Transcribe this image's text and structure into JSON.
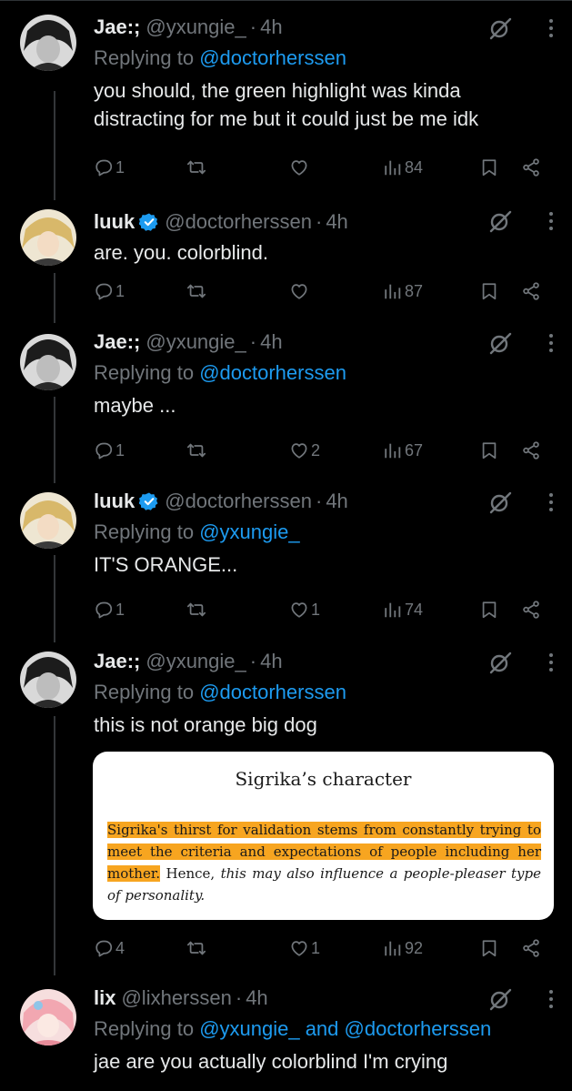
{
  "colors": {
    "background": "#000000",
    "text_primary": "#e7e9ea",
    "text_secondary": "#71767b",
    "mention_blue": "#1d9bf0",
    "verified_blue": "#1d9bf0",
    "highlight_orange": "#f7a520",
    "thread_line": "#333639"
  },
  "icons": {
    "reply": "speech-bubble-icon",
    "retweet": "retweet-arrows-icon",
    "like": "heart-icon",
    "views": "bar-chart-icon",
    "bookmark": "bookmark-icon",
    "share": "share-nodes-icon",
    "grok": "grok-slash-circle-icon",
    "more": "vertical-ellipsis-icon",
    "verified": "verified-badge-icon"
  },
  "tweets": [
    {
      "name": "Jae:;",
      "handle": "@yxungie_",
      "dot": "·",
      "time": "4h",
      "replying_prefix": "Replying to ",
      "replying_to": "@doctorherssen",
      "text": "you should, the green highlight was kinda distracting for me but it could just be me idk",
      "reply_count": "1",
      "like_count": "",
      "views": "84"
    },
    {
      "name": "luuk",
      "verified": true,
      "handle": "@doctorherssen",
      "dot": "·",
      "time": "4h",
      "text": "are. you. colorblind.",
      "reply_count": "1",
      "like_count": "",
      "views": "87"
    },
    {
      "name": "Jae:;",
      "handle": "@yxungie_",
      "dot": "·",
      "time": "4h",
      "replying_prefix": "Replying to ",
      "replying_to": "@doctorherssen",
      "text": "maybe ...",
      "reply_count": "1",
      "like_count": "2",
      "views": "67"
    },
    {
      "name": "luuk",
      "verified": true,
      "handle": "@doctorherssen",
      "dot": "·",
      "time": "4h",
      "replying_prefix": "Replying to ",
      "replying_to": "@yxungie_",
      "text": "IT'S ORANGE...",
      "reply_count": "1",
      "like_count": "1",
      "views": "74"
    },
    {
      "name": "Jae:;",
      "handle": "@yxungie_",
      "dot": "·",
      "time": "4h",
      "replying_prefix": "Replying to ",
      "replying_to": "@doctorherssen",
      "text": "this is not orange big dog",
      "reply_count": "4",
      "like_count": "1",
      "views": "92",
      "image": {
        "title": "Sigrika’s character",
        "highlighted_text": "Sigrika's thirst for validation stems from constantly trying to meet the criteria and expectations of people including her mother.",
        "plain_text": " Hence, ",
        "italic_text": "this may also influence a people-pleaser type of personality."
      }
    },
    {
      "name": "lix",
      "handle": "@lixherssen",
      "dot": "·",
      "time": "4h",
      "replying_prefix": "Replying to ",
      "replying_to": "@yxungie_ and @doctorherssen",
      "text": "jae are you actually colorblind I'm crying"
    }
  ]
}
